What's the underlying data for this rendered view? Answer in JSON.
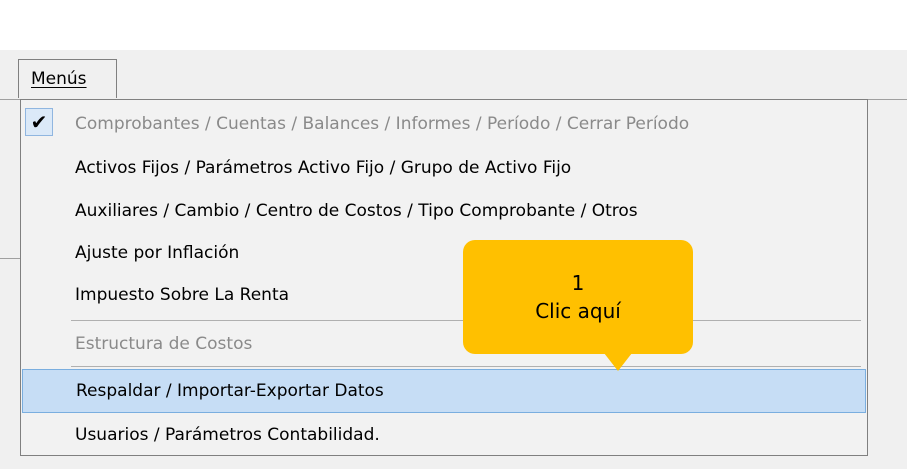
{
  "menubar": {
    "menus_label": "Menús"
  },
  "menu": {
    "items": [
      {
        "label": "Comprobantes / Cuentas / Balances / Informes / Período / Cerrar Período",
        "state": "disabled",
        "checked": true
      },
      {
        "label": "Activos Fijos / Parámetros Activo Fijo / Grupo de Activo Fijo",
        "state": "enabled"
      },
      {
        "label": "Auxiliares / Cambio / Centro de Costos / Tipo Comprobante / Otros",
        "state": "enabled"
      },
      {
        "label": "Ajuste por Inflación",
        "state": "enabled"
      },
      {
        "label": "Impuesto Sobre La Renta",
        "state": "enabled"
      },
      {
        "label": "Estructura de Costos",
        "state": "disabled"
      },
      {
        "label": "Respaldar / Importar-Exportar Datos",
        "state": "highlighted"
      },
      {
        "label": "Usuarios / Parámetros Contabilidad.",
        "state": "enabled"
      }
    ],
    "check_icon": "check-icon"
  },
  "callout": {
    "number": "1",
    "text": "Clic aquí"
  },
  "colors": {
    "callout": "#ffc000",
    "highlight": "#c6ddf5",
    "highlight_border": "#7aaedf",
    "disabled_text": "#8a8a8a"
  }
}
